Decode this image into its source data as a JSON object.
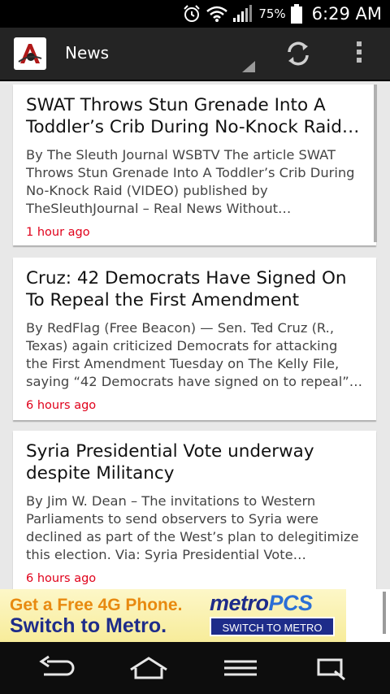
{
  "status_bar": {
    "battery_percent": "75%",
    "time": "6:29 AM",
    "icons": [
      "alarm-icon",
      "wifi-icon",
      "signal-icon",
      "battery-icon"
    ]
  },
  "action_bar": {
    "title": "News",
    "icons": [
      "app-logo-icon",
      "refresh-icon",
      "overflow-menu-icon"
    ]
  },
  "articles": [
    {
      "title": "SWAT Throws Stun Grenade Into A Toddler’s Crib During No-Knock Raid…",
      "summary": "By The Sleuth Journal WSBTV The article SWAT Throws Stun Grenade Into A Toddler’s Crib During No-Knock Raid (VIDEO) published by TheSleuthJournal – Real News Without…",
      "time": "1 hour ago"
    },
    {
      "title": "Cruz: 42 Democrats Have Signed On To Repeal the First Amendment",
      "summary": "By RedFlag (Free Beacon) — Sen. Ted Cruz (R., Texas) again criticized Democrats for attacking the First Amendment Tuesday on The Kelly File, saying “42 Democrats have signed on to repeal”…",
      "time": "6 hours ago"
    },
    {
      "title": "Syria Presidential Vote underway despite Militancy",
      "summary": "By Jim W. Dean – The invitations to Western Parliaments to send observers to Syria were declined as part of the West’s plan to delegitimize this election. Via: Syria Presidential Vote…",
      "time": "6 hours ago"
    }
  ],
  "ad": {
    "line1": "Get a Free 4G Phone.",
    "line2": "Switch to Metro.",
    "brand_a": "metro",
    "brand_b": "PCS",
    "button": "SWITCH TO METRO"
  },
  "nav_bar": {
    "icons": [
      "back-icon",
      "home-icon",
      "menu-icon",
      "recent-apps-icon"
    ]
  },
  "colors": {
    "accent_time": "#e0001a",
    "action_bar": "#242424",
    "ad_blue": "#1e2c8a",
    "ad_orange": "#e88a10"
  }
}
